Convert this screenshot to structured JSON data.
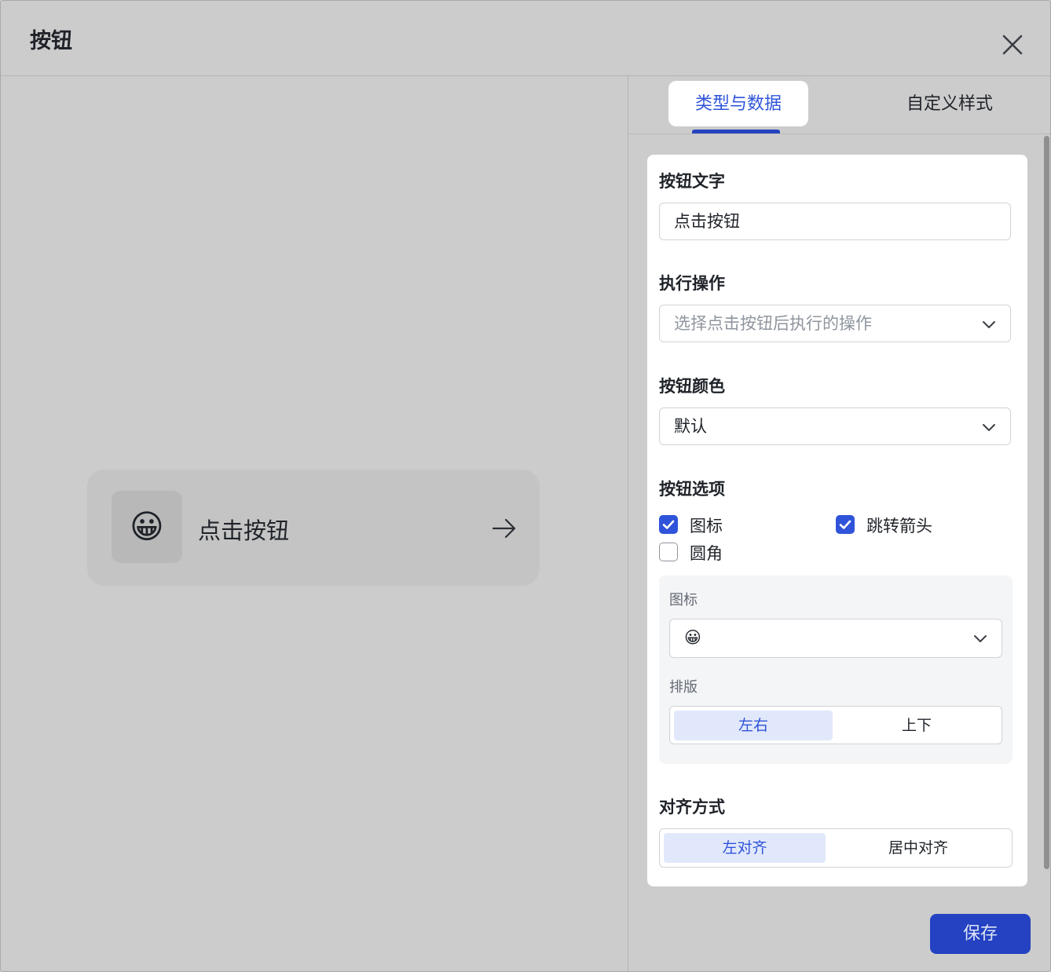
{
  "dialog": {
    "title": "按钮"
  },
  "preview": {
    "button_label": "点击按钮",
    "icon": "grinning-face-emoji",
    "icon_glyph": "😀"
  },
  "tabs": [
    {
      "label": "类型与数据",
      "active": true
    },
    {
      "label": "自定义样式",
      "active": false
    }
  ],
  "form": {
    "button_text": {
      "label": "按钮文字",
      "value": "点击按钮"
    },
    "action": {
      "label": "执行操作",
      "placeholder": "选择点击按钮后执行的操作"
    },
    "color": {
      "label": "按钮颜色",
      "value": "默认"
    },
    "options": {
      "label": "按钮选项",
      "items": [
        {
          "label": "图标",
          "checked": true
        },
        {
          "label": "跳转箭头",
          "checked": true
        },
        {
          "label": "圆角",
          "checked": false
        }
      ]
    },
    "icon_settings": {
      "icon_label": "图标",
      "icon_glyph": "😀",
      "layout_label": "排版",
      "layout_options": [
        {
          "label": "左右",
          "active": true
        },
        {
          "label": "上下",
          "active": false
        }
      ]
    },
    "alignment": {
      "label": "对齐方式",
      "options": [
        {
          "label": "左对齐",
          "active": true
        },
        {
          "label": "居中对齐",
          "active": false
        }
      ]
    }
  },
  "footer": {
    "save_label": "保存"
  },
  "colors": {
    "accent": "#2f54d9",
    "primary_button": "#2442c2"
  }
}
